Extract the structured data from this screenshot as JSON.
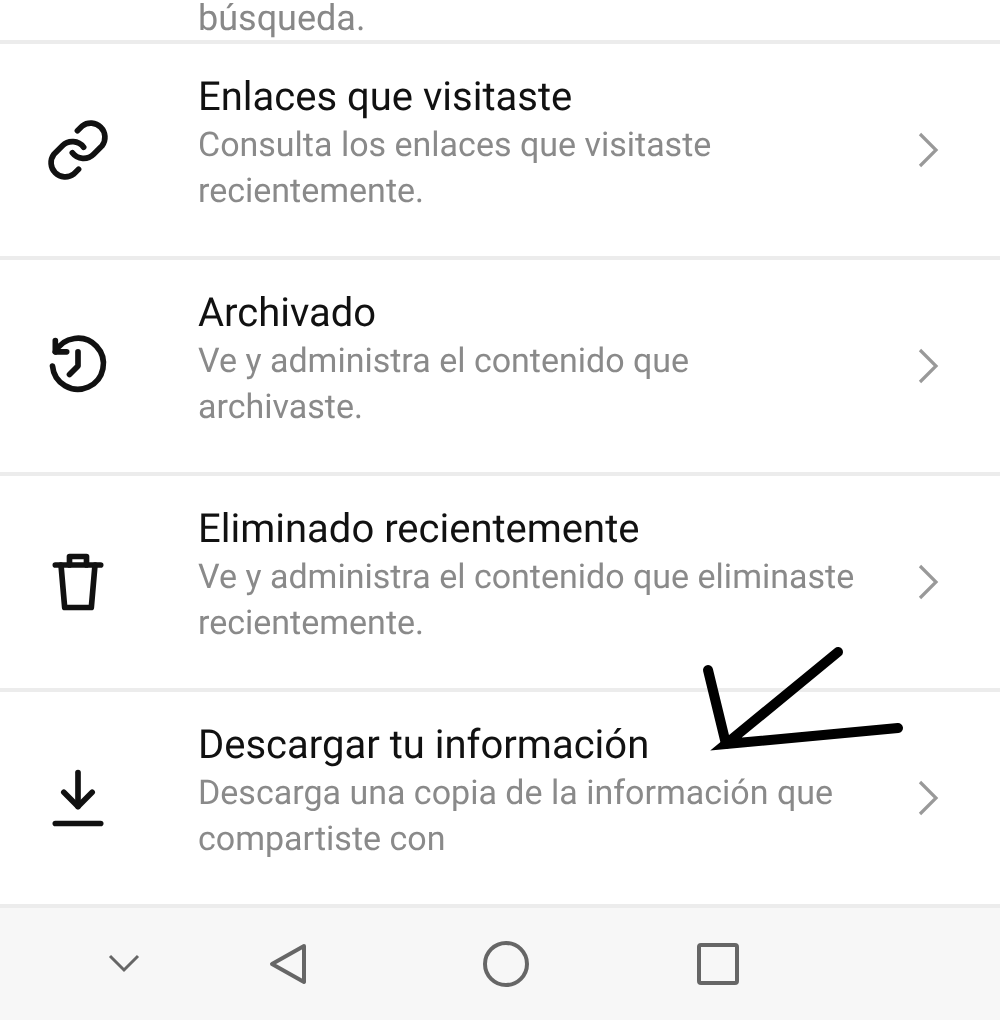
{
  "top_partial_text": "búsqueda.",
  "items": [
    {
      "kind": "link",
      "title": "Enlaces que visitaste",
      "subtitle": "Consulta los enlaces que visitaste recientemente."
    },
    {
      "kind": "archive",
      "title": "Archivado",
      "subtitle": "Ve y administra el contenido que archivaste."
    },
    {
      "kind": "trash",
      "title": "Eliminado recientemente",
      "subtitle": "Ve y administra el contenido que eliminaste recientemente."
    },
    {
      "kind": "download",
      "title": "Descargar tu información",
      "subtitle": "Descarga una copia de la información que compartiste con"
    }
  ]
}
